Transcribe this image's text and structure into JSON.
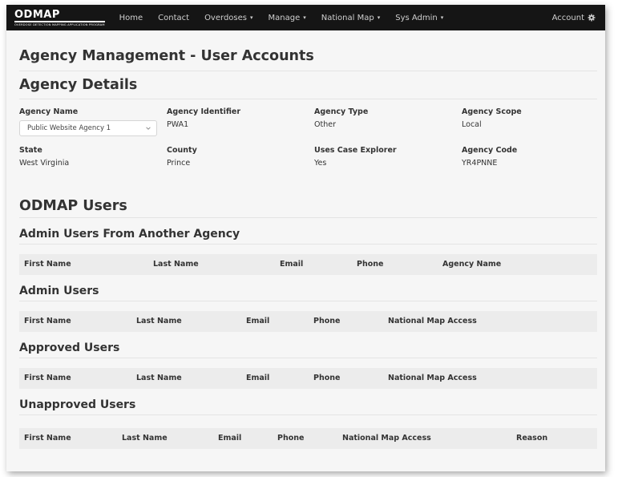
{
  "navbar": {
    "logo": "ODMAP",
    "logo_sub": "OVERDOSE DETECTION MAPPING APPLICATION PROGRAM",
    "items": [
      {
        "label": "Home",
        "dropdown": false
      },
      {
        "label": "Contact",
        "dropdown": false
      },
      {
        "label": "Overdoses",
        "dropdown": true
      },
      {
        "label": "Manage",
        "dropdown": true
      },
      {
        "label": "National Map",
        "dropdown": true
      },
      {
        "label": "Sys Admin",
        "dropdown": true
      }
    ],
    "account": "Account"
  },
  "page_title": "Agency Management - User Accounts",
  "agency_details": {
    "title": "Agency Details",
    "agency_name_label": "Agency Name",
    "agency_name_value": "Public Website Agency 1",
    "agency_identifier_label": "Agency Identifier",
    "agency_identifier_value": "PWA1",
    "agency_type_label": "Agency Type",
    "agency_type_value": "Other",
    "agency_scope_label": "Agency Scope",
    "agency_scope_value": "Local",
    "state_label": "State",
    "state_value": "West Virginia",
    "county_label": "County",
    "county_value": "Prince",
    "case_explorer_label": "Uses Case Explorer",
    "case_explorer_value": "Yes",
    "agency_code_label": "Agency Code",
    "agency_code_value": "YR4PNNE"
  },
  "users": {
    "title": "ODMAP Users",
    "sections": [
      {
        "title": "Admin Users From Another Agency",
        "columns": [
          "First Name",
          "Last Name",
          "Email",
          "Phone",
          "Agency Name"
        ]
      },
      {
        "title": "Admin Users",
        "columns": [
          "First Name",
          "Last Name",
          "Email",
          "Phone",
          "National Map Access"
        ]
      },
      {
        "title": "Approved Users",
        "columns": [
          "First Name",
          "Last Name",
          "Email",
          "Phone",
          "National Map Access"
        ]
      },
      {
        "title": "Unapproved Users",
        "columns": [
          "First Name",
          "Last Name",
          "Email",
          "Phone",
          "National Map Access",
          "Reason"
        ]
      }
    ]
  }
}
